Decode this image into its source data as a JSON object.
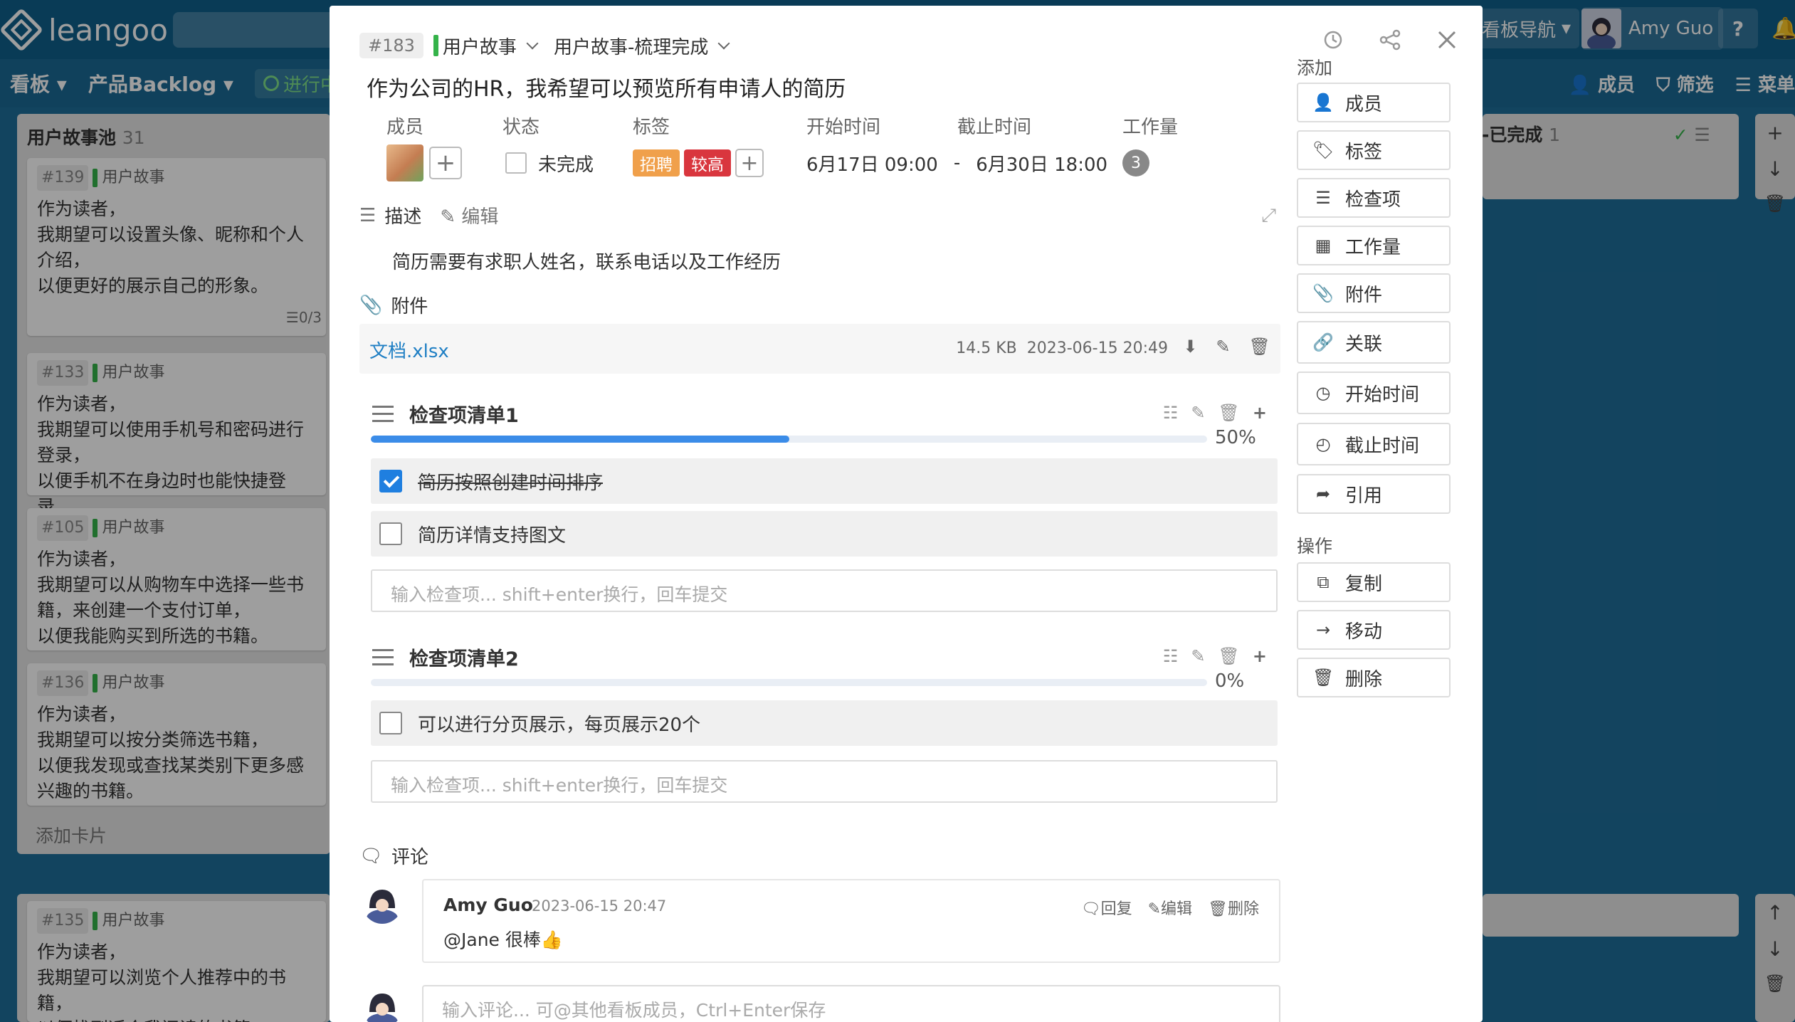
{
  "app": {
    "logo": "leangoo",
    "board_nav": "看板导航",
    "user_name": "Amy Guo",
    "help": "?",
    "board_label": "看板",
    "project": "产品Backlog",
    "status": "进行中",
    "member_label": "成员",
    "filter_label": "筛选",
    "menu_label": "菜单"
  },
  "lane": {
    "title": "用户故事池",
    "count": "31",
    "cards": [
      {
        "id": "#139",
        "type": "用户故事",
        "text": "作为读者，\n我期望可以设置头像、昵称和个人介绍，\n以便更好的展示自己的形象。",
        "badge": "0/3"
      },
      {
        "id": "#133",
        "type": "用户故事",
        "text": "作为读者，\n我期望可以使用手机号和密码进行登录，\n以便手机不在身边时也能快捷登录。"
      },
      {
        "id": "#105",
        "type": "用户故事",
        "text": "作为读者，\n我期望可以从购物车中选择一些书籍，来创建一个支付订单，\n以便我能购买到所选的书籍。"
      },
      {
        "id": "#136",
        "type": "用户故事",
        "text": "作为读者，\n我期望可以按分类筛选书籍，\n以便我发现或查找某类别下更多感兴趣的书籍。"
      }
    ],
    "add_card": "添加卡片"
  },
  "lane_bottom": {
    "card": {
      "id": "#135",
      "type": "用户故事",
      "text": "作为读者，\n我期望可以浏览个人推荐中的书籍，\n以便找到适合我阅读的书籍。"
    }
  },
  "right_lane": {
    "title": "-已完成",
    "count": "1"
  },
  "card_detail": {
    "id": "#183",
    "type": "用户故事",
    "list": "用户故事-梳理完成",
    "title": "作为公司的HR，我希望可以预览所有申请人的简历",
    "labels": {
      "members": "成员",
      "status": "状态",
      "tags": "标签",
      "start": "开始时间",
      "due": "截止时间",
      "workload": "工作量"
    },
    "status_value": "未完成",
    "tags": [
      {
        "text": "招聘",
        "color": "#f0a04b"
      },
      {
        "text": "较高",
        "color": "#d9363e"
      }
    ],
    "start_time": "6月17日 09:00",
    "dash": "-",
    "due_time": "6月30日 18:00",
    "workload_value": "3",
    "description": {
      "label": "描述",
      "edit": "编辑",
      "text": "简历需要有求职人姓名，联系电话以及工作经历"
    },
    "attachments": {
      "label": "附件",
      "items": [
        {
          "name": "文档.xlsx",
          "size": "14.5 KB",
          "time": "2023-06-15 20:49"
        }
      ]
    },
    "checklists": [
      {
        "title": "检查项清单1",
        "progress": 50,
        "percent": "50%",
        "items": [
          {
            "text": "简历按照创建时间排序",
            "done": true
          },
          {
            "text": "简历详情支持图文",
            "done": false
          }
        ],
        "placeholder": "输入检查项... shift+enter换行，回车提交"
      },
      {
        "title": "检查项清单2",
        "progress": 0,
        "percent": "0%",
        "items": [
          {
            "text": "可以进行分页展示，每页展示20个",
            "done": false
          }
        ],
        "placeholder": "输入检查项... shift+enter换行，回车提交"
      }
    ],
    "comments": {
      "label": "评论",
      "items": [
        {
          "author": "Amy Guo",
          "time": "2023-06-15 20:47",
          "text": "@Jane 很棒👍",
          "reply": "回复",
          "edit": "编辑",
          "delete": "删除"
        }
      ],
      "placeholder": "输入评论... 可@其他看板成员，Ctrl+Enter保存"
    }
  },
  "sidebar": {
    "add_heading": "添加",
    "add_items": [
      {
        "label": "成员",
        "icon": "add-member-icon"
      },
      {
        "label": "标签",
        "icon": "tag-icon"
      },
      {
        "label": "检查项",
        "icon": "checklist-icon"
      },
      {
        "label": "工作量",
        "icon": "workload-grid-icon"
      },
      {
        "label": "附件",
        "icon": "paperclip-icon"
      },
      {
        "label": "关联",
        "icon": "link-icon"
      },
      {
        "label": "开始时间",
        "icon": "clock-icon"
      },
      {
        "label": "截止时间",
        "icon": "due-clock-icon"
      },
      {
        "label": "引用",
        "icon": "share-arrow-icon"
      }
    ],
    "ops_heading": "操作",
    "ops_items": [
      {
        "label": "复制",
        "icon": "copy-icon"
      },
      {
        "label": "移动",
        "icon": "arrow-right-icon"
      },
      {
        "label": "删除",
        "icon": "trash-icon"
      }
    ]
  }
}
